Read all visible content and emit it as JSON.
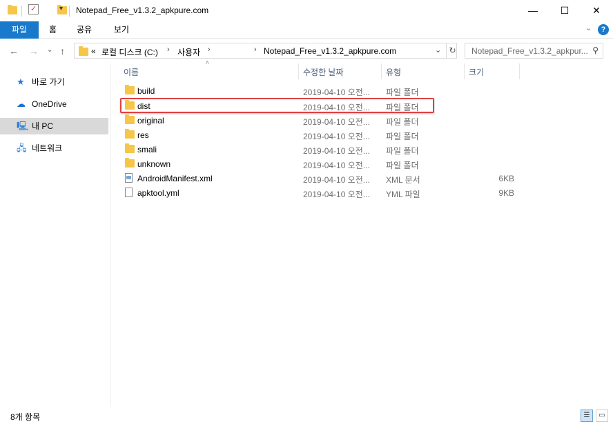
{
  "window": {
    "title": "Notepad_Free_v1.3.2_apkpure.com",
    "minimize": "—",
    "maximize": "☐",
    "close": "✕"
  },
  "ribbon": {
    "tabs": [
      "파일",
      "홈",
      "공유",
      "보기"
    ],
    "expand_glyph": "⌄",
    "help_glyph": "?"
  },
  "address": {
    "prefix": "«",
    "crumbs": [
      "로컬 디스크 (C:)",
      "사용자",
      "Notepad_Free_v1.3.2_apkpure.com"
    ],
    "search_placeholder": "Notepad_Free_v1.3.2_apkpur..."
  },
  "nav": {
    "items": [
      {
        "label": "바로 가기",
        "icon": "star-icon"
      },
      {
        "label": "OneDrive",
        "icon": "cloud-icon"
      },
      {
        "label": "내 PC",
        "icon": "computer-icon"
      },
      {
        "label": "네트워크",
        "icon": "network-icon"
      }
    ]
  },
  "columns": {
    "name": "이름",
    "modified": "수정한 날짜",
    "type": "유형",
    "size": "크기"
  },
  "files": [
    {
      "name": "build",
      "date": "2019-04-10 오전...",
      "type": "파일 폴더",
      "size": "",
      "kind": "folder"
    },
    {
      "name": "dist",
      "date": "2019-04-10 오전...",
      "type": "파일 폴더",
      "size": "",
      "kind": "folder"
    },
    {
      "name": "original",
      "date": "2019-04-10 오전...",
      "type": "파일 폴더",
      "size": "",
      "kind": "folder"
    },
    {
      "name": "res",
      "date": "2019-04-10 오전...",
      "type": "파일 폴더",
      "size": "",
      "kind": "folder"
    },
    {
      "name": "smali",
      "date": "2019-04-10 오전...",
      "type": "파일 폴더",
      "size": "",
      "kind": "folder"
    },
    {
      "name": "unknown",
      "date": "2019-04-10 오전...",
      "type": "파일 폴더",
      "size": "",
      "kind": "folder"
    },
    {
      "name": "AndroidManifest.xml",
      "date": "2019-04-10 오전...",
      "type": "XML 문서",
      "size": "6KB",
      "kind": "xml"
    },
    {
      "name": "apktool.yml",
      "date": "2019-04-10 오전...",
      "type": "YML 파일",
      "size": "9KB",
      "kind": "file"
    }
  ],
  "status": {
    "count": "8개 항목"
  },
  "colors": {
    "accent": "#1979ca",
    "folder": "#f6c64a",
    "highlight": "#e04040"
  }
}
